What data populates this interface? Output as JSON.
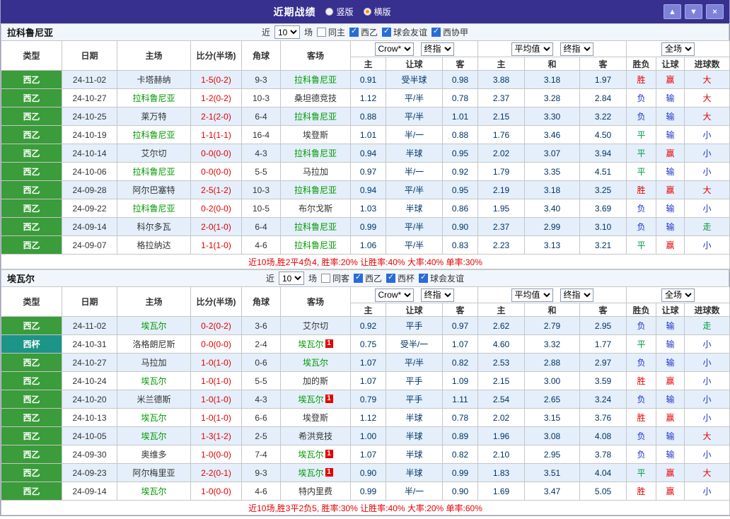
{
  "titlebar": {
    "title": "近期战绩",
    "radios": [
      {
        "label": "竖版",
        "selected": false
      },
      {
        "label": "横版",
        "selected": true
      }
    ],
    "buttons": {
      "up": "▲",
      "down": "▼",
      "close": "×"
    }
  },
  "table_headers": {
    "static": [
      "类型",
      "日期",
      "主场",
      "比分(半场)",
      "角球",
      "客场"
    ],
    "group1_selects": [
      "Crow*",
      "终指"
    ],
    "group2_selects": [
      "平均值",
      "终指"
    ],
    "group3_selects": [
      "全场"
    ],
    "sub": [
      "主",
      "让球",
      "客",
      "主",
      "和",
      "客",
      "胜负",
      "让球",
      "进球数"
    ]
  },
  "colors": {
    "titlebar_bg": "#37308f",
    "row_alt": "#e4effb",
    "league": {
      "西乙": "#3a9c3a",
      "西杯": "#1d9488"
    },
    "focus_team": "#009900",
    "score": "#e60000",
    "odds": "#003366",
    "result": {
      "胜": "#e60000",
      "赢": "#e60000",
      "大": "#e60000",
      "负": "#2233cc",
      "输": "#2233cc",
      "小": "#2233cc",
      "平": "#009944",
      "走": "#009944"
    },
    "summary": "#e60000",
    "badge": "#e60000"
  },
  "sections": [
    {
      "team": "拉科鲁尼亚",
      "filter": {
        "prefix": "近",
        "count": "10",
        "suffix": "场",
        "checks": [
          {
            "label": "同主",
            "checked": false
          },
          {
            "label": "西乙",
            "checked": true
          },
          {
            "label": "球会友谊",
            "checked": true
          },
          {
            "label": "西协甲",
            "checked": true
          }
        ]
      },
      "rows": [
        {
          "league": "西乙",
          "date": "24-11-02",
          "home": "卡塔赫纳",
          "score": "1-5(0-2)",
          "corner": "9-3",
          "away": "拉科鲁尼亚",
          "odds": [
            "0.91",
            "受半球",
            "0.98"
          ],
          "avg": [
            "3.88",
            "3.18",
            "1.97"
          ],
          "res": [
            "胜",
            "赢",
            "大"
          ]
        },
        {
          "league": "西乙",
          "date": "24-10-27",
          "home": "拉科鲁尼亚",
          "score": "1-2(0-2)",
          "corner": "10-3",
          "away": "桑坦德竞技",
          "odds": [
            "1.12",
            "平/半",
            "0.78"
          ],
          "avg": [
            "2.37",
            "3.28",
            "2.84"
          ],
          "res": [
            "负",
            "输",
            "大"
          ]
        },
        {
          "league": "西乙",
          "date": "24-10-25",
          "home": "莱万特",
          "score": "2-1(2-0)",
          "corner": "6-4",
          "away": "拉科鲁尼亚",
          "odds": [
            "0.88",
            "平/半",
            "1.01"
          ],
          "avg": [
            "2.15",
            "3.30",
            "3.22"
          ],
          "res": [
            "负",
            "输",
            "大"
          ]
        },
        {
          "league": "西乙",
          "date": "24-10-19",
          "home": "拉科鲁尼亚",
          "score": "1-1(1-1)",
          "corner": "16-4",
          "away": "埃登斯",
          "odds": [
            "1.01",
            "半/一",
            "0.88"
          ],
          "avg": [
            "1.76",
            "3.46",
            "4.50"
          ],
          "res": [
            "平",
            "输",
            "小"
          ]
        },
        {
          "league": "西乙",
          "date": "24-10-14",
          "home": "艾尔切",
          "score": "0-0(0-0)",
          "corner": "4-3",
          "away": "拉科鲁尼亚",
          "odds": [
            "0.94",
            "半球",
            "0.95"
          ],
          "avg": [
            "2.02",
            "3.07",
            "3.94"
          ],
          "res": [
            "平",
            "赢",
            "小"
          ]
        },
        {
          "league": "西乙",
          "date": "24-10-06",
          "home": "拉科鲁尼亚",
          "score": "0-0(0-0)",
          "corner": "5-5",
          "away": "马拉加",
          "odds": [
            "0.97",
            "半/一",
            "0.92"
          ],
          "avg": [
            "1.79",
            "3.35",
            "4.51"
          ],
          "res": [
            "平",
            "输",
            "小"
          ]
        },
        {
          "league": "西乙",
          "date": "24-09-28",
          "home": "阿尔巴塞特",
          "score": "2-5(1-2)",
          "corner": "10-3",
          "away": "拉科鲁尼亚",
          "odds": [
            "0.94",
            "平/半",
            "0.95"
          ],
          "avg": [
            "2.19",
            "3.18",
            "3.25"
          ],
          "res": [
            "胜",
            "赢",
            "大"
          ]
        },
        {
          "league": "西乙",
          "date": "24-09-22",
          "home": "拉科鲁尼亚",
          "score": "0-2(0-0)",
          "corner": "10-5",
          "away": "布尔戈斯",
          "odds": [
            "1.03",
            "半球",
            "0.86"
          ],
          "avg": [
            "1.95",
            "3.40",
            "3.69"
          ],
          "res": [
            "负",
            "输",
            "小"
          ]
        },
        {
          "league": "西乙",
          "date": "24-09-14",
          "home": "科尔多瓦",
          "score": "2-0(1-0)",
          "corner": "6-4",
          "away": "拉科鲁尼亚",
          "odds": [
            "0.99",
            "平/半",
            "0.90"
          ],
          "avg": [
            "2.37",
            "2.99",
            "3.10"
          ],
          "res": [
            "负",
            "输",
            "走"
          ]
        },
        {
          "league": "西乙",
          "date": "24-09-07",
          "home": "格拉纳达",
          "score": "1-1(1-0)",
          "corner": "4-6",
          "away": "拉科鲁尼亚",
          "odds": [
            "1.06",
            "平/半",
            "0.83"
          ],
          "avg": [
            "2.23",
            "3.13",
            "3.21"
          ],
          "res": [
            "平",
            "赢",
            "小"
          ]
        }
      ],
      "summary": "近10场,胜2平4负4, 胜率:20% 让胜率:40% 大率:40% 单率:30%"
    },
    {
      "team": "埃瓦尔",
      "filter": {
        "prefix": "近",
        "count": "10",
        "suffix": "场",
        "checks": [
          {
            "label": "同客",
            "checked": false
          },
          {
            "label": "西乙",
            "checked": true
          },
          {
            "label": "西杯",
            "checked": true
          },
          {
            "label": "球会友谊",
            "checked": true
          }
        ]
      },
      "rows": [
        {
          "league": "西乙",
          "date": "24-11-02",
          "home": "埃瓦尔",
          "score": "0-2(0-2)",
          "corner": "3-6",
          "away": "艾尔切",
          "odds": [
            "0.92",
            "平手",
            "0.97"
          ],
          "avg": [
            "2.62",
            "2.79",
            "2.95"
          ],
          "res": [
            "负",
            "输",
            "走"
          ]
        },
        {
          "league": "西杯",
          "date": "24-10-31",
          "home": "洛格朗尼斯",
          "score": "0-0(0-0)",
          "corner": "2-4",
          "away": "埃瓦尔",
          "away_badge": "1",
          "odds": [
            "0.75",
            "受半/一",
            "1.07"
          ],
          "avg": [
            "4.60",
            "3.32",
            "1.77"
          ],
          "res": [
            "平",
            "输",
            "小"
          ]
        },
        {
          "league": "西乙",
          "date": "24-10-27",
          "home": "马拉加",
          "score": "1-0(1-0)",
          "corner": "0-6",
          "away": "埃瓦尔",
          "odds": [
            "1.07",
            "平/半",
            "0.82"
          ],
          "avg": [
            "2.53",
            "2.88",
            "2.97"
          ],
          "res": [
            "负",
            "输",
            "小"
          ]
        },
        {
          "league": "西乙",
          "date": "24-10-24",
          "home": "埃瓦尔",
          "score": "1-0(1-0)",
          "corner": "5-5",
          "away": "加的斯",
          "odds": [
            "1.07",
            "平手",
            "1.09"
          ],
          "avg": [
            "2.15",
            "3.00",
            "3.59"
          ],
          "res": [
            "胜",
            "赢",
            "小"
          ]
        },
        {
          "league": "西乙",
          "date": "24-10-20",
          "home": "米兰德斯",
          "score": "1-0(1-0)",
          "corner": "4-3",
          "away": "埃瓦尔",
          "away_badge": "1",
          "odds": [
            "0.79",
            "平手",
            "1.11"
          ],
          "avg": [
            "2.54",
            "2.65",
            "3.24"
          ],
          "res": [
            "负",
            "输",
            "小"
          ]
        },
        {
          "league": "西乙",
          "date": "24-10-13",
          "home": "埃瓦尔",
          "score": "1-0(1-0)",
          "corner": "6-6",
          "away": "埃登斯",
          "odds": [
            "1.12",
            "半球",
            "0.78"
          ],
          "avg": [
            "2.02",
            "3.15",
            "3.76"
          ],
          "res": [
            "胜",
            "赢",
            "小"
          ]
        },
        {
          "league": "西乙",
          "date": "24-10-05",
          "home": "埃瓦尔",
          "score": "1-3(1-2)",
          "corner": "2-5",
          "away": "希洪竞技",
          "odds": [
            "1.00",
            "半球",
            "0.89"
          ],
          "avg": [
            "1.96",
            "3.08",
            "4.08"
          ],
          "res": [
            "负",
            "输",
            "大"
          ]
        },
        {
          "league": "西乙",
          "date": "24-09-30",
          "home": "奥维多",
          "score": "1-0(0-0)",
          "corner": "7-4",
          "away": "埃瓦尔",
          "away_badge": "1",
          "odds": [
            "1.07",
            "半球",
            "0.82"
          ],
          "avg": [
            "2.10",
            "2.95",
            "3.78"
          ],
          "res": [
            "负",
            "输",
            "小"
          ]
        },
        {
          "league": "西乙",
          "date": "24-09-23",
          "home": "阿尔梅里亚",
          "score": "2-2(0-1)",
          "corner": "9-3",
          "away": "埃瓦尔",
          "away_badge": "1",
          "odds": [
            "0.90",
            "半球",
            "0.99"
          ],
          "avg": [
            "1.83",
            "3.51",
            "4.04"
          ],
          "res": [
            "平",
            "赢",
            "大"
          ]
        },
        {
          "league": "西乙",
          "date": "24-09-14",
          "home": "埃瓦尔",
          "score": "1-0(0-0)",
          "corner": "4-6",
          "away": "特内里费",
          "odds": [
            "0.99",
            "半/一",
            "0.90"
          ],
          "avg": [
            "1.69",
            "3.47",
            "5.05"
          ],
          "res": [
            "胜",
            "赢",
            "小"
          ]
        }
      ],
      "summary": "近10场,胜3平2负5, 胜率:30% 让胜率:40% 大率:20% 单率:60%"
    }
  ]
}
